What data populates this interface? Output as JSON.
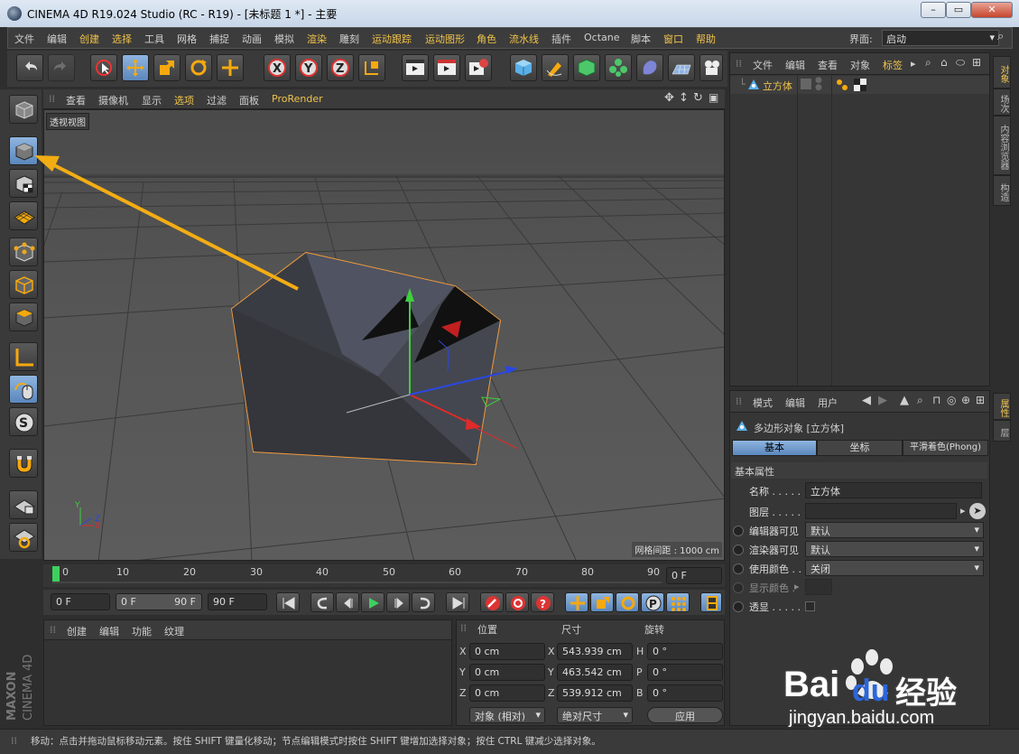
{
  "title_bar": {
    "title": "CINEMA 4D R19.024 Studio (RC - R19) - [未标题 1 *] - 主要"
  },
  "menu": {
    "items": [
      "文件",
      "编辑",
      "创建",
      "选择",
      "工具",
      "网格",
      "捕捉",
      "动画",
      "模拟",
      "渲染",
      "雕刻",
      "运动跟踪",
      "运动图形",
      "角色",
      "流水线",
      "插件",
      "Octane",
      "脚本",
      "窗口",
      "帮助"
    ],
    "layout_label": "界面:",
    "layout_value": "启动"
  },
  "toolbar": {
    "x_label": "X",
    "y_label": "Y",
    "z_label": "Z"
  },
  "viewport": {
    "menu": [
      "查看",
      "摄像机",
      "显示",
      "选项",
      "过滤",
      "面板",
      "ProRender"
    ],
    "label": "透视视图",
    "grid_spacing": "网格间距 : 1000 cm"
  },
  "timeline": {
    "ticks": [
      "0",
      "10",
      "20",
      "30",
      "40",
      "50",
      "60",
      "70",
      "80",
      "90"
    ],
    "current_frame": "0 F",
    "start_field": "0 F",
    "range_start": "0 F",
    "range_end": "90 F",
    "end_field": "90 F"
  },
  "material_panel": {
    "menu": [
      "创建",
      "编辑",
      "功能",
      "纹理"
    ]
  },
  "coords": {
    "headers": [
      "位置",
      "尺寸",
      "旋转"
    ],
    "rows": [
      {
        "pos_axis": "X",
        "pos": "0 cm",
        "size_axis": "X",
        "size": "543.939 cm",
        "rot_axis": "H",
        "rot": "0 °"
      },
      {
        "pos_axis": "Y",
        "pos": "0 cm",
        "size_axis": "Y",
        "size": "463.542 cm",
        "rot_axis": "P",
        "rot": "0 °"
      },
      {
        "pos_axis": "Z",
        "pos": "0 cm",
        "size_axis": "Z",
        "size": "539.912 cm",
        "rot_axis": "B",
        "rot": "0 °"
      }
    ],
    "mode": "对象 (相对)",
    "size_mode": "绝对尺寸",
    "apply": "应用"
  },
  "object_manager": {
    "menu": [
      "文件",
      "编辑",
      "查看",
      "对象",
      "标签"
    ],
    "objects": [
      {
        "name": "立方体"
      }
    ],
    "side_tabs": [
      "对象",
      "场次",
      "内容浏览器",
      "构造"
    ]
  },
  "attributes": {
    "menu": [
      "模式",
      "编辑",
      "用户"
    ],
    "header": "多边形对象 [立方体]",
    "tabs": [
      "基本",
      "坐标",
      "平滑着色(Phong)"
    ],
    "section": "基本属性",
    "fields": [
      {
        "label": "名称 . . . . .",
        "value": "立方体"
      },
      {
        "label": "图层 . . . . .",
        "value": ""
      },
      {
        "label": "编辑器可见",
        "value": "默认"
      },
      {
        "label": "渲染器可见",
        "value": "默认"
      },
      {
        "label": "使用颜色 . .",
        "value": "关闭"
      },
      {
        "label": "显示颜色 .",
        "value": ""
      },
      {
        "label": "透显 . . . . .",
        "value": ""
      }
    ],
    "side_tabs": [
      "属性",
      "层"
    ]
  },
  "brand": {
    "line1": "MAXON",
    "line2": "CINEMA 4D"
  },
  "status": "移动：点击并拖动鼠标移动元素。按住 SHIFT 键量化移动；节点编辑模式时按住 SHIFT 键增加选择对象；按住 CTRL 键减少选择对象。",
  "watermark": {
    "text1": "Bai",
    "text2": "du",
    "text3": "经验",
    "url": "jingyan.baidu.com"
  },
  "colors": {
    "accent": "#f0c34a",
    "selection": "#6e99c9",
    "arrow": "#f3ad14"
  }
}
